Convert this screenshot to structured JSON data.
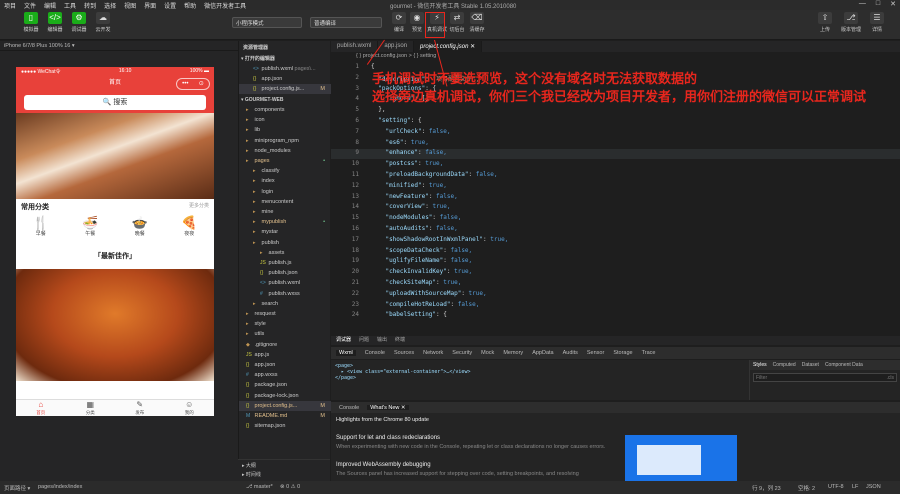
{
  "menubar": {
    "items": [
      "项目",
      "文件",
      "编辑",
      "工具",
      "转到",
      "选择",
      "视图",
      "界面",
      "设置",
      "帮助",
      "微信开发者工具"
    ],
    "window_title": "gourmet - 微信开发者工具 Stable 1.05.2010080",
    "controls": [
      "—",
      "□",
      "✕"
    ]
  },
  "toolbar": {
    "left_buttons": [
      {
        "label": "模拟器",
        "icon": "phone-icon"
      },
      {
        "label": "编辑器",
        "icon": "code-icon"
      },
      {
        "label": "调试器",
        "icon": "debug-icon"
      },
      {
        "label": "云开发",
        "icon": "cloud-icon"
      }
    ],
    "mode_select": "小程序模式",
    "compile_select": "普通编译",
    "center_buttons": [
      {
        "label": "编译",
        "icon": "refresh-icon"
      },
      {
        "label": "预览",
        "icon": "eye-icon"
      },
      {
        "label": "真机调试",
        "icon": "phone-debug-icon"
      },
      {
        "label": "切后台",
        "icon": "switch-icon"
      },
      {
        "label": "清缓存",
        "icon": "clear-icon"
      }
    ],
    "right_buttons": [
      {
        "label": "上传",
        "icon": "upload-icon"
      },
      {
        "label": "版本管理",
        "icon": "version-icon"
      },
      {
        "label": "详情",
        "icon": "detail-icon"
      }
    ]
  },
  "simulator": {
    "device": "iPhone 6/7/8 Plus 100% 16 ▾",
    "status_carrier": "●●●●● WeChat令",
    "status_time": "16:10",
    "status_battery": "100% ▬",
    "nav_title": "首页",
    "capsule": [
      "•••",
      "⊙"
    ],
    "search_label": "🔍 搜索",
    "category_title": "常用分类",
    "category_more": "更多分类",
    "categories": [
      {
        "label": "早餐",
        "icon": "🍴"
      },
      {
        "label": "午餐",
        "icon": "🍜"
      },
      {
        "label": "晚餐",
        "icon": "🍲"
      },
      {
        "label": "夜夜",
        "icon": "🍕"
      }
    ],
    "latest_title": "「最新佳作」",
    "tabs": [
      {
        "label": "首页",
        "icon": "⌂"
      },
      {
        "label": "分类",
        "icon": "▦"
      },
      {
        "label": "发布",
        "icon": "✎"
      },
      {
        "label": "我的",
        "icon": "☺"
      }
    ]
  },
  "explorer": {
    "header": "资源管理器",
    "open_editors": "▾ 打开的编辑器",
    "open_files": [
      {
        "name": "publish.wxml",
        "extra": "pages\\...",
        "mod": "",
        "type": "wxml"
      },
      {
        "name": "app.json",
        "extra": "",
        "mod": "",
        "type": "json"
      },
      {
        "name": "project.config.js...",
        "extra": "",
        "mod": "M",
        "type": "json"
      }
    ],
    "project": "▾ GOURMET-WEB",
    "tree": [
      {
        "name": "components",
        "indent": 1,
        "type": "folder",
        "mod": ""
      },
      {
        "name": "icon",
        "indent": 1,
        "type": "folder",
        "mod": ""
      },
      {
        "name": "lib",
        "indent": 1,
        "type": "folder",
        "mod": ""
      },
      {
        "name": "miniprogram_npm",
        "indent": 1,
        "type": "folder",
        "mod": ""
      },
      {
        "name": "node_modules",
        "indent": 1,
        "type": "folder",
        "mod": ""
      },
      {
        "name": "pages",
        "indent": 1,
        "type": "folder",
        "mod": "•"
      },
      {
        "name": "classify",
        "indent": 2,
        "type": "folder",
        "mod": ""
      },
      {
        "name": "index",
        "indent": 2,
        "type": "folder",
        "mod": ""
      },
      {
        "name": "login",
        "indent": 2,
        "type": "folder",
        "mod": ""
      },
      {
        "name": "menucontent",
        "indent": 2,
        "type": "folder",
        "mod": ""
      },
      {
        "name": "mine",
        "indent": 2,
        "type": "folder",
        "mod": ""
      },
      {
        "name": "mypublish",
        "indent": 2,
        "type": "folder",
        "mod": "•"
      },
      {
        "name": "mystar",
        "indent": 2,
        "type": "folder",
        "mod": ""
      },
      {
        "name": "publish",
        "indent": 2,
        "type": "folder",
        "mod": ""
      },
      {
        "name": "assets",
        "indent": 3,
        "type": "folder",
        "mod": ""
      },
      {
        "name": "publish.js",
        "indent": 3,
        "type": "js",
        "mod": ""
      },
      {
        "name": "publish.json",
        "indent": 3,
        "type": "json",
        "mod": ""
      },
      {
        "name": "publish.wxml",
        "indent": 3,
        "type": "wxml",
        "mod": ""
      },
      {
        "name": "publish.wxss",
        "indent": 3,
        "type": "wxss",
        "mod": ""
      },
      {
        "name": "search",
        "indent": 2,
        "type": "folder",
        "mod": ""
      },
      {
        "name": "resquest",
        "indent": 1,
        "type": "folder",
        "mod": ""
      },
      {
        "name": "style",
        "indent": 1,
        "type": "folder",
        "mod": ""
      },
      {
        "name": "utils",
        "indent": 1,
        "type": "folder",
        "mod": ""
      },
      {
        "name": ".gitignore",
        "indent": 1,
        "type": "file",
        "mod": ""
      },
      {
        "name": "app.js",
        "indent": 1,
        "type": "js",
        "mod": ""
      },
      {
        "name": "app.json",
        "indent": 1,
        "type": "json",
        "mod": ""
      },
      {
        "name": "app.wxss",
        "indent": 1,
        "type": "wxss",
        "mod": ""
      },
      {
        "name": "package.json",
        "indent": 1,
        "type": "json",
        "mod": ""
      },
      {
        "name": "package-lock.json",
        "indent": 1,
        "type": "json",
        "mod": ""
      },
      {
        "name": "project.config.js...",
        "indent": 1,
        "type": "json",
        "mod": "M"
      },
      {
        "name": "README.md",
        "indent": 1,
        "type": "md",
        "mod": "M"
      },
      {
        "name": "sitemap.json",
        "indent": 1,
        "type": "json",
        "mod": ""
      }
    ],
    "outline": "▸ 大纲",
    "timeline": "▸ 时间线"
  },
  "editor": {
    "tabs": [
      {
        "label": "publish.wxml",
        "active": false
      },
      {
        "label": "app.json",
        "active": false
      },
      {
        "label": "project.config.json ✕",
        "active": true
      }
    ],
    "breadcrumb": "{ } project.config.json > { } setting",
    "lines": [
      {
        "n": "1",
        "t": "{"
      },
      {
        "n": "2",
        "t": "  \"description\": \"项目配置文件\","
      },
      {
        "n": "3",
        "t": "  \"packOptions\": {"
      },
      {
        "n": "4",
        "t": "    \"ignore\": []"
      },
      {
        "n": "5",
        "t": "  },"
      },
      {
        "n": "6",
        "t": "  \"setting\": {"
      },
      {
        "n": "7",
        "t": "    \"urlCheck\": false,"
      },
      {
        "n": "8",
        "t": "    \"es6\": true,"
      },
      {
        "n": "9",
        "t": "    \"enhance\": false,"
      },
      {
        "n": "10",
        "t": "    \"postcss\": true,"
      },
      {
        "n": "11",
        "t": "    \"preloadBackgroundData\": false,"
      },
      {
        "n": "12",
        "t": "    \"minified\": true,"
      },
      {
        "n": "13",
        "t": "    \"newFeature\": false,"
      },
      {
        "n": "14",
        "t": "    \"coverView\": true,"
      },
      {
        "n": "15",
        "t": "    \"nodeModules\": false,"
      },
      {
        "n": "16",
        "t": "    \"autoAudits\": false,"
      },
      {
        "n": "17",
        "t": "    \"showShadowRootInWxmlPanel\": true,"
      },
      {
        "n": "18",
        "t": "    \"scopeDataCheck\": false,"
      },
      {
        "n": "19",
        "t": "    \"uglifyFileName\": false,"
      },
      {
        "n": "20",
        "t": "    \"checkInvalidKey\": true,"
      },
      {
        "n": "21",
        "t": "    \"checkSiteMap\": true,"
      },
      {
        "n": "22",
        "t": "    \"uploadWithSourceMap\": true,"
      },
      {
        "n": "23",
        "t": "    \"compileHotReLoad\": false,"
      },
      {
        "n": "24",
        "t": "    \"babelSetting\": {"
      }
    ]
  },
  "annotation": {
    "line1": "手机调试时不要选预览，这个没有域名时无法获取数据的",
    "line2": "选择旁边真机调试，你们三个我已经改为项目开发者，用你们注册的微信可以正常调试"
  },
  "devtools": {
    "top_tabs": [
      "调试器",
      "问题",
      "输出",
      "终端"
    ],
    "panel_tabs": [
      "Wxml",
      "Console",
      "Sources",
      "Network",
      "Security",
      "Mock",
      "Memory",
      "AppData",
      "Audits",
      "Sensor",
      "Storage",
      "Trace"
    ],
    "dom_lines": [
      "<page>",
      "  ▸ <view class=\"external-container\">…</view>",
      "</page>"
    ],
    "styles_tabs": [
      "Styles",
      "Computed",
      "Dataset",
      "Component Data"
    ],
    "filter_placeholder": "Filter",
    "filter_right": ".cls",
    "drawer_tabs": [
      "Console",
      "What's New ✕"
    ],
    "highlights": "Highlights from the Chrome 80 update",
    "item1_title": "Support for let and class redeclarations",
    "item1_desc": "When experimenting with new code in the Console, repeating let or class declarations no longer causes errors.",
    "item2_title": "Improved WebAssembly debugging",
    "item2_desc": "The Sources panel has increased support for stepping over code, setting breakpoints, and resolving"
  },
  "statusbar": {
    "left": "页面路径 ▾",
    "path": "pages/index/index",
    "branch": "⎇ master*",
    "sync": "⊗ 0 ⚠ 0",
    "position": "行 9，列 23",
    "spaces": "空格: 2",
    "encoding": "UTF-8",
    "eol": "LF",
    "lang": "JSON"
  }
}
